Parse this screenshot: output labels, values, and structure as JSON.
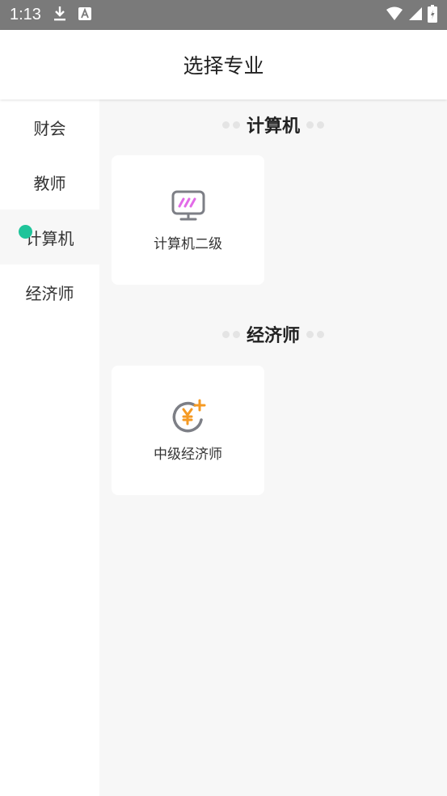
{
  "status_bar": {
    "time": "1:13",
    "icons": [
      "download-icon",
      "text-notification-icon",
      "wifi-icon",
      "signal-icon",
      "battery-icon"
    ]
  },
  "app_bar": {
    "title": "选择专业"
  },
  "sidebar": {
    "items": [
      {
        "label": "财会",
        "active": false
      },
      {
        "label": "教师",
        "active": false
      },
      {
        "label": "计算机",
        "active": true
      },
      {
        "label": "经济师",
        "active": false
      }
    ]
  },
  "sections": [
    {
      "title": "计算机",
      "cards": [
        {
          "label": "计算机二级",
          "icon": "monitor-icon"
        }
      ]
    },
    {
      "title": "经济师",
      "cards": [
        {
          "label": "中级经济师",
          "icon": "yuan-plus-icon"
        }
      ]
    }
  ],
  "colors": {
    "accent": "#1fc49a",
    "icon_pink": "#e26be8",
    "icon_orange": "#f59a23",
    "icon_gray": "#7d7f86"
  }
}
